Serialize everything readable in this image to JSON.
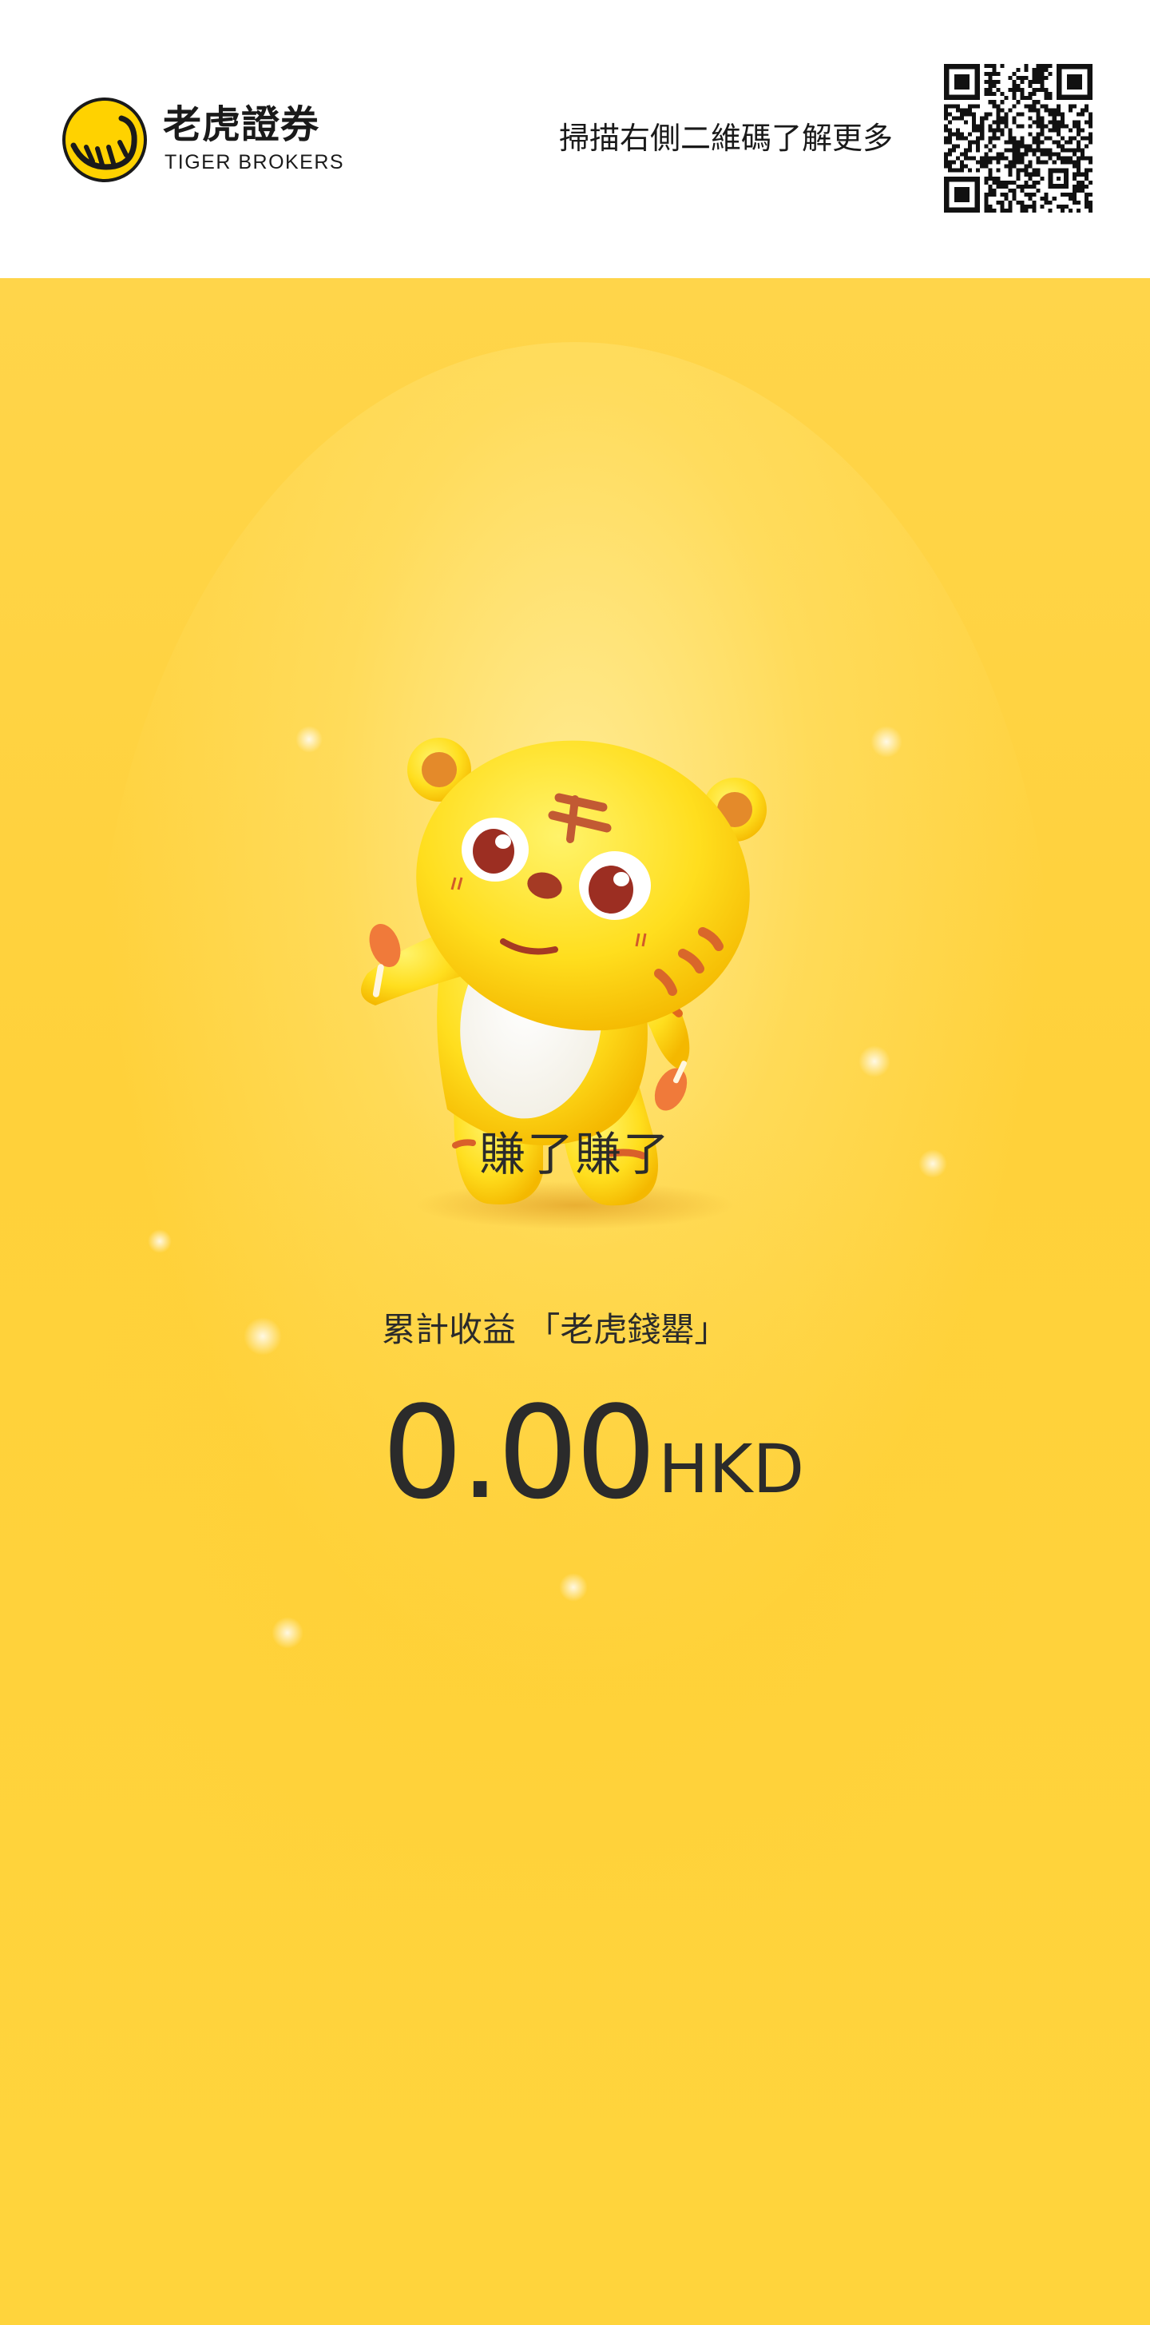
{
  "header": {
    "brand_cn": "老虎證券",
    "brand_en": "TIGER BROKERS",
    "scan_hint": "掃描右側二維碼了解更多",
    "logo_icon": "tiger-stripes-logo-icon",
    "qr_icon": "qr-code-icon"
  },
  "main": {
    "mascot": "tiger-mascot",
    "title": "賺了賺了",
    "cumulative_label": "累計收益 「老虎錢罌」",
    "amount": "0.00",
    "currency": "HKD"
  },
  "colors": {
    "background_yellow": "#ffd43c",
    "text_dark": "#2b2b2b",
    "logo_yellow": "#ffd200"
  }
}
